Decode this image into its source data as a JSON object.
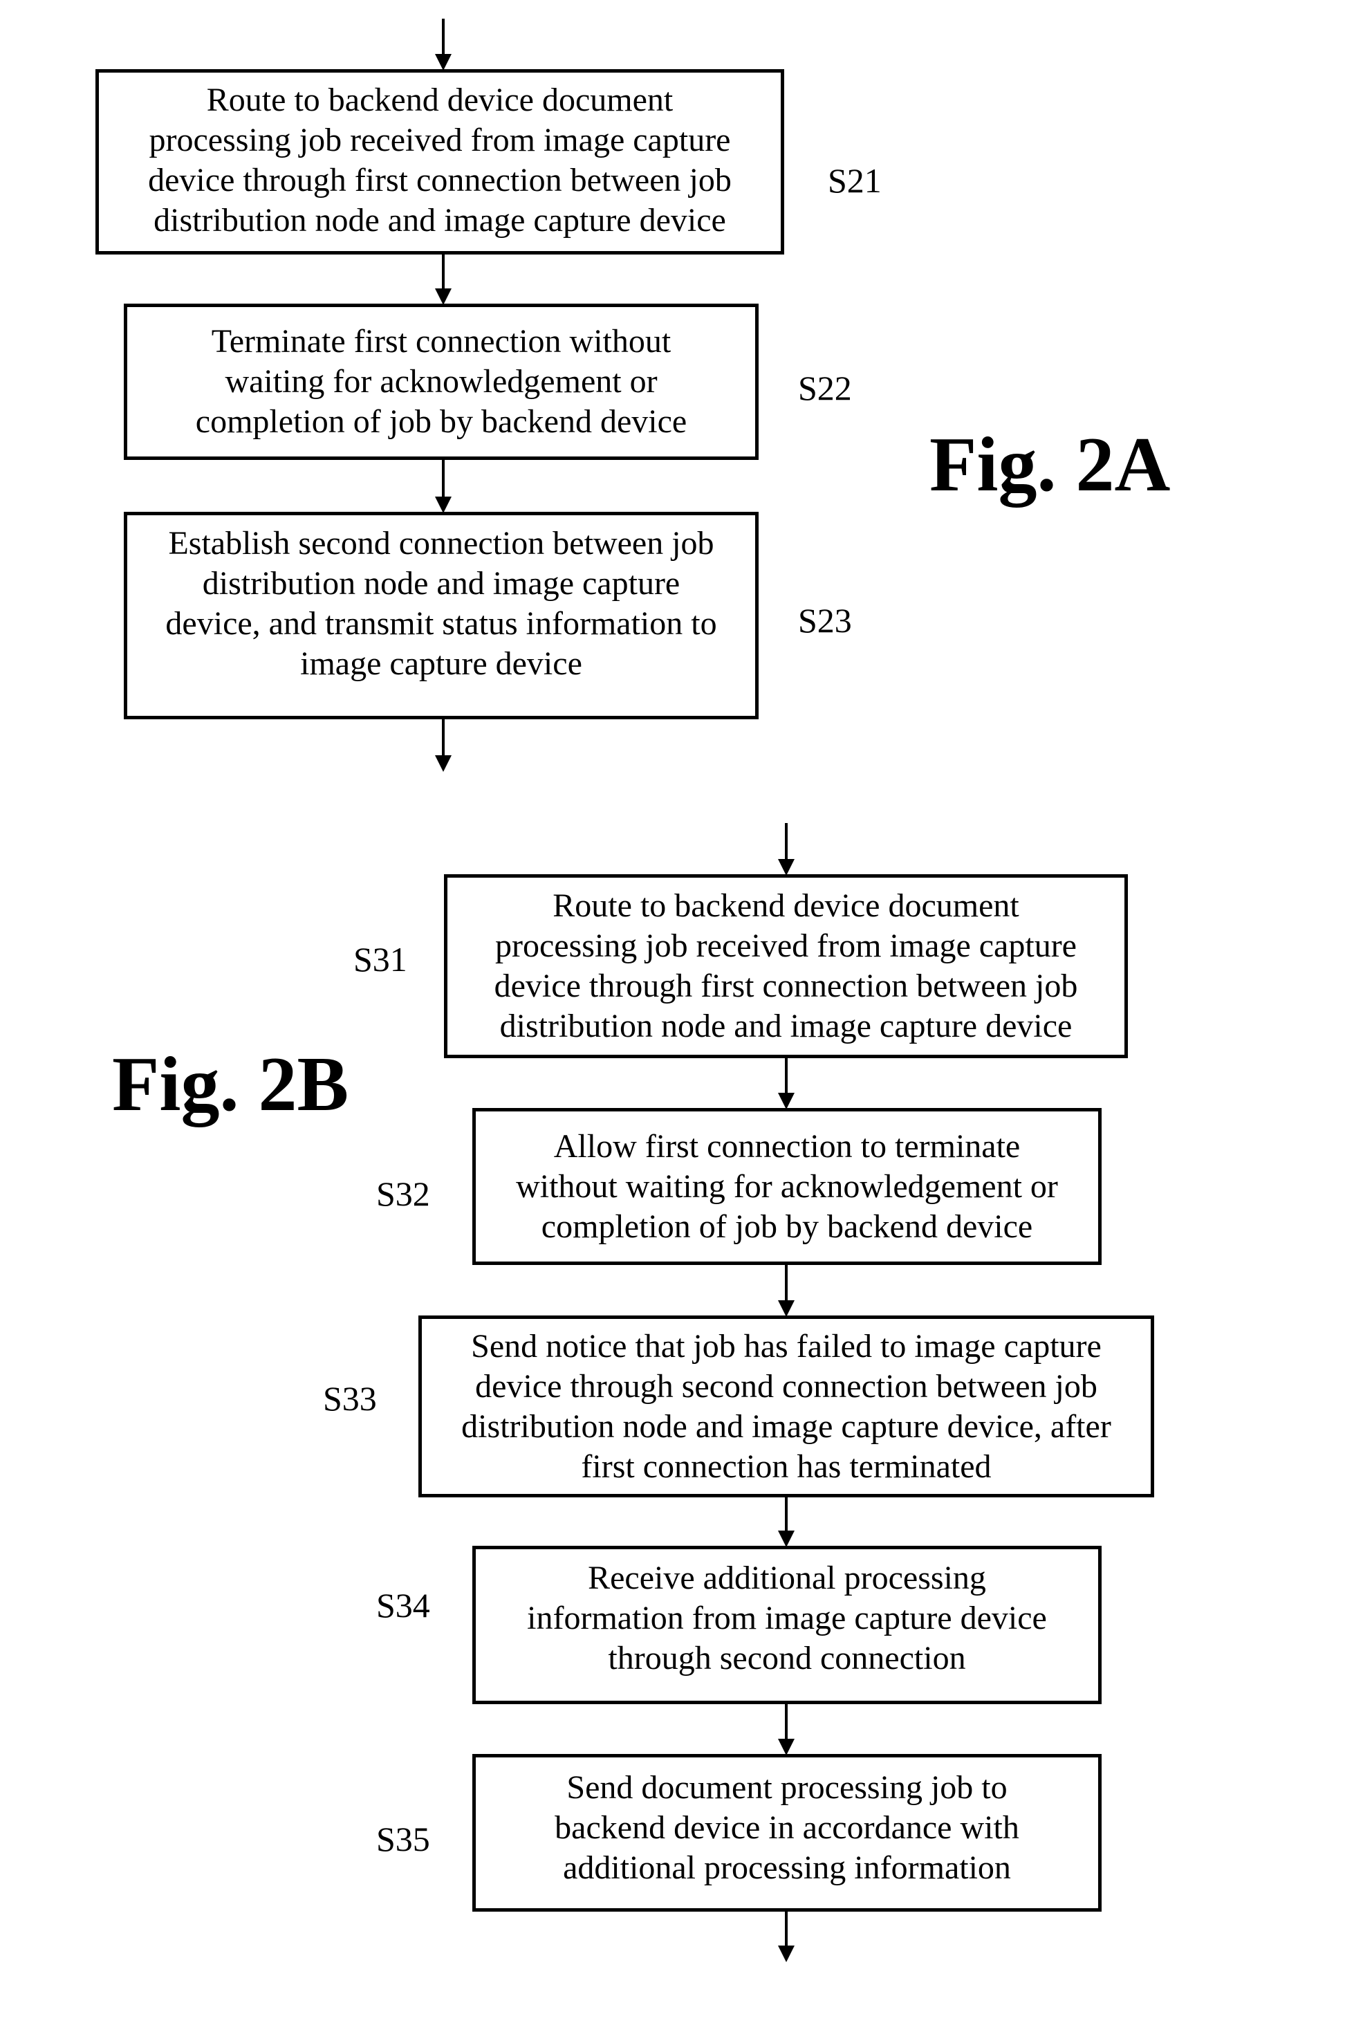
{
  "figures": [
    {
      "id": "fig2a",
      "title": "Fig. 2A",
      "steps": [
        {
          "label": "S21",
          "lines": [
            "Route to backend device document",
            "processing job received from image capture",
            "device through first connection between job",
            "distribution node and image capture device"
          ]
        },
        {
          "label": "S22",
          "lines": [
            "Terminate first connection without",
            "waiting for acknowledgement or",
            "completion of job by backend device"
          ]
        },
        {
          "label": "S23",
          "lines": [
            "Establish second connection between job",
            "distribution node and image capture",
            "device, and transmit status information to",
            "image capture device"
          ]
        }
      ]
    },
    {
      "id": "fig2b",
      "title": "Fig. 2B",
      "steps": [
        {
          "label": "S31",
          "lines": [
            "Route to backend device document",
            "processing job received from image capture",
            "device through first connection between job",
            "distribution node and image capture device"
          ]
        },
        {
          "label": "S32",
          "lines": [
            "Allow first connection to terminate",
            "without waiting for acknowledgement or",
            "completion of job by backend device"
          ]
        },
        {
          "label": "S33",
          "lines": [
            "Send notice that job has failed to image capture",
            "device through second connection between job",
            "distribution node and image capture device, after",
            "first connection has terminated"
          ]
        },
        {
          "label": "S34",
          "lines": [
            "Receive additional processing",
            "information from image capture device",
            "through second connection"
          ]
        },
        {
          "label": "S35",
          "lines": [
            "Send document processing job to",
            "backend device in accordance with",
            "additional processing information"
          ]
        }
      ]
    }
  ]
}
